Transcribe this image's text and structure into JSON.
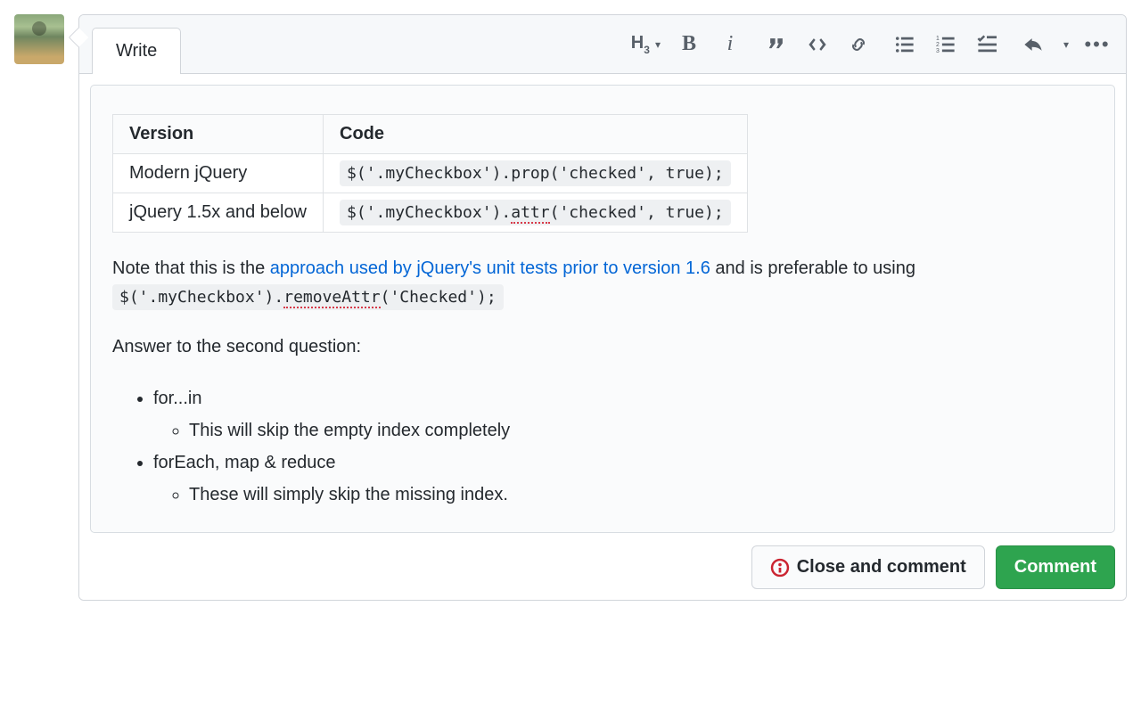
{
  "tabs": {
    "write": "Write"
  },
  "toolbar": {
    "heading": "H"
  },
  "table": {
    "headers": [
      "Version",
      "Code"
    ],
    "rows": [
      {
        "version": "Modern jQuery",
        "code": "$('.myCheckbox').prop('checked', true);"
      },
      {
        "version": "jQuery 1.5x and below",
        "code_pre": "$('.myCheckbox').",
        "code_spell": "attr",
        "code_post": "('checked', true);"
      }
    ]
  },
  "note": {
    "pre": "Note that this is the ",
    "link": "approach used by jQuery's unit tests prior to version 1.6",
    "mid": " and is preferable to using ",
    "code_pre": "$('.myCheckbox').",
    "code_spell": "removeAttr",
    "code_post": "('Checked');"
  },
  "answer_heading": "Answer to the second question:",
  "list": [
    {
      "label": "for...in",
      "sub": "This will skip the empty index completely"
    },
    {
      "label": "forEach, map & reduce",
      "sub": "These will simply skip the missing index."
    }
  ],
  "buttons": {
    "close": "Close and comment",
    "comment": "Comment"
  }
}
